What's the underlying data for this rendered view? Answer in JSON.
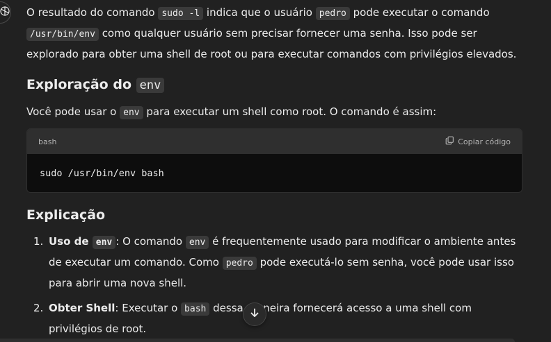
{
  "intro": {
    "t1": "O resultado do comando ",
    "c1": "sudo -l",
    "t2": " indica que o usuário ",
    "c2": "pedro",
    "t3": " pode executar o comando ",
    "c3": "/usr/bin/env",
    "t4": " como qualquer usuário sem precisar fornecer uma senha. Isso pode ser explorado para obter uma shell de root ou para executar comandos com privilégios elevados."
  },
  "section1": {
    "title": "Exploração do ",
    "title_code": "env",
    "p_t1": "Você pode usar o ",
    "p_c1": "env",
    "p_t2": " para executar um shell como root. O comando é assim:"
  },
  "codeblock": {
    "language": "bash",
    "copy_label": "Copiar código",
    "code": "sudo /usr/bin/env bash"
  },
  "section2": {
    "title": "Explicação",
    "items": [
      {
        "num": "1.",
        "bold": "Uso de ",
        "bold_code": "env",
        "t1": ": O comando ",
        "c1": "env",
        "t2": " é frequentemente usado para modificar o ambiente antes de executar um comando. Como ",
        "c2": "pedro",
        "t3": " pode executá-lo sem senha, você pode usar isso para abrir uma nova shell."
      },
      {
        "num": "2.",
        "bold": "Obter Shell",
        "t1": ": Executar o ",
        "c1": "bash",
        "t2": " dessa maneira fornecerá acesso a uma shell com privilégios de root."
      }
    ]
  },
  "icons": {
    "avatar": "openai-logo-icon",
    "copy": "copy-icon",
    "scroll": "arrow-down-icon"
  }
}
